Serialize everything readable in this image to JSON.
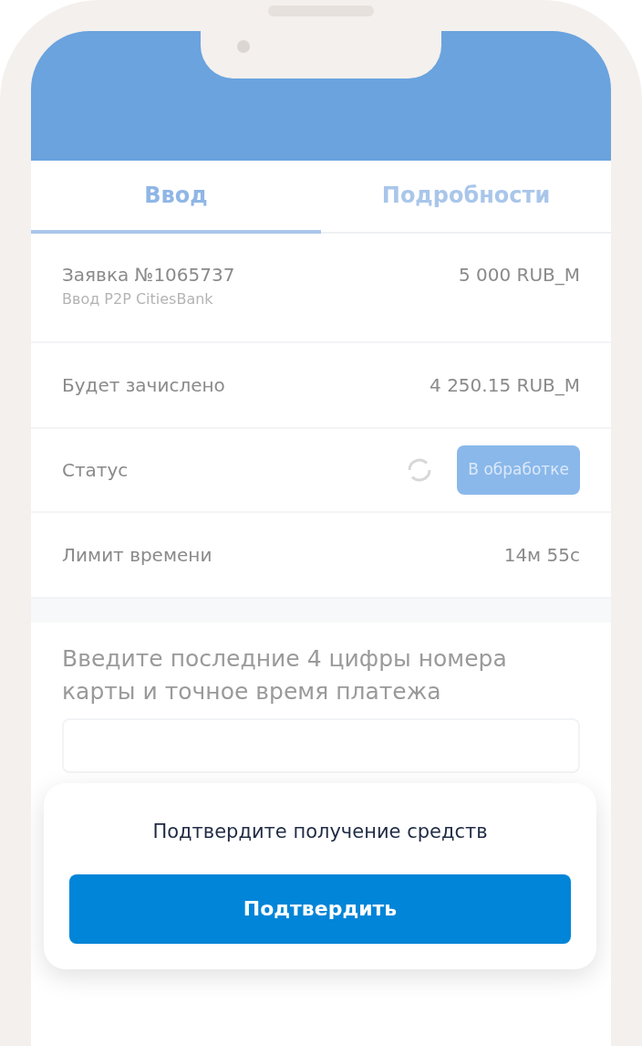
{
  "tabs": [
    {
      "label": "Ввод",
      "selected": true
    },
    {
      "label": "Подробности",
      "selected": false
    }
  ],
  "order": {
    "title": "Заявка №1065737",
    "subtitle": "Ввод P2P CitiesBank",
    "amount": "5 000 RUB_M"
  },
  "details": [
    {
      "kind": "text",
      "label": "Будет зачислено",
      "value": "4 250.15 RUB_M"
    },
    {
      "kind": "status",
      "label": "Статус",
      "value": "В обработке"
    },
    {
      "kind": "text",
      "label": "Лимит времени",
      "value": "14м 55с"
    }
  ],
  "prompt": "Введите последние 4 цифры номера карты и точное время платежа",
  "confirm": {
    "message": "Подтвердите получение средств",
    "button": "Подтвердить"
  }
}
